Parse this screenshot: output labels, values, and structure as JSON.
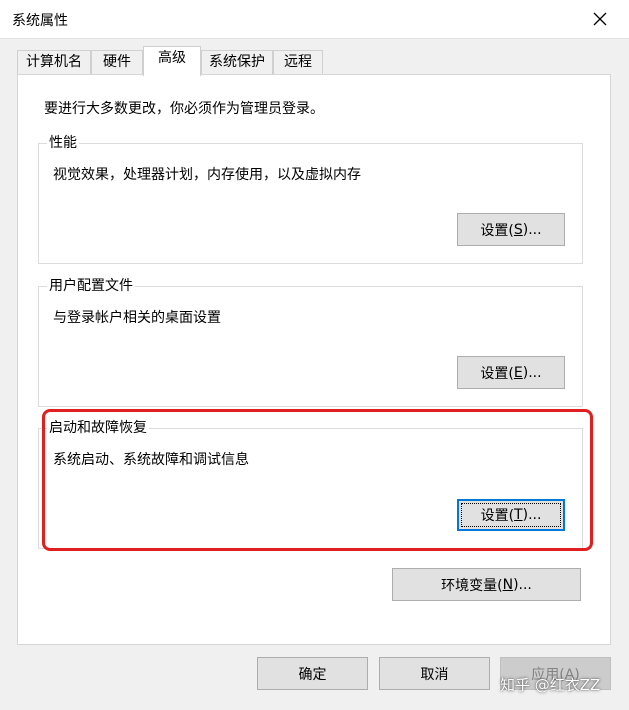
{
  "window": {
    "title": "系统属性"
  },
  "tabs": [
    {
      "label": "计算机名",
      "active": false
    },
    {
      "label": "硬件",
      "active": false
    },
    {
      "label": "高级",
      "active": true
    },
    {
      "label": "系统保护",
      "active": false
    },
    {
      "label": "远程",
      "active": false
    }
  ],
  "notice": "要进行大多数更改，你必须作为管理员登录。",
  "groups": {
    "performance": {
      "title": "性能",
      "description": "视觉效果，处理器计划，内存使用，以及虚拟内存",
      "button": {
        "prefix": "设置(",
        "key": "S",
        "suffix": ")..."
      }
    },
    "user_profiles": {
      "title": "用户配置文件",
      "description": "与登录帐户相关的桌面设置",
      "button": {
        "prefix": "设置(",
        "key": "E",
        "suffix": ")..."
      }
    },
    "startup_recovery": {
      "title": "启动和故障恢复",
      "description": "系统启动、系统故障和调试信息",
      "button": {
        "prefix": "设置(",
        "key": "T",
        "suffix": ")..."
      }
    }
  },
  "env_button": {
    "prefix": "环境变量(",
    "key": "N",
    "suffix": ")..."
  },
  "footer": {
    "ok": "确定",
    "cancel": "取消",
    "apply": "应用(A)"
  },
  "watermark": "知乎 @红衣ZZ",
  "colors": {
    "highlight": "#e02020",
    "focus": "#0078d7"
  }
}
